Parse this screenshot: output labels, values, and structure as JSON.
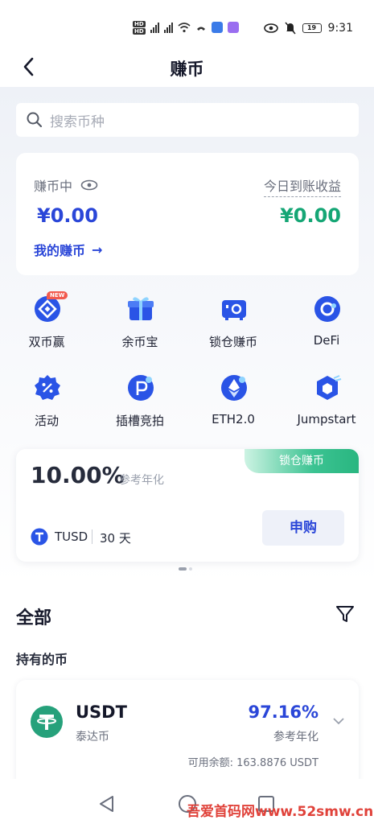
{
  "status_bar": {
    "time": "9:31",
    "battery": "19"
  },
  "header": {
    "title": "赚币"
  },
  "search": {
    "placeholder": "搜索币种"
  },
  "earnings": {
    "label": "赚币中",
    "amount": "¥0.00",
    "today_label": "今日到账收益",
    "today_amount": "¥0.00",
    "my_link": "我的赚币",
    "link_arrow": "→"
  },
  "grid": {
    "items": [
      {
        "label": "双币赢",
        "icon": "dual-coin-icon",
        "badge": "NEW"
      },
      {
        "label": "余币宝",
        "icon": "gift-box-icon"
      },
      {
        "label": "锁仓赚币",
        "icon": "safe-lock-icon"
      },
      {
        "label": "DeFi",
        "icon": "defi-icon"
      },
      {
        "label": "活动",
        "icon": "activity-percent-icon"
      },
      {
        "label": "插槽竞拍",
        "icon": "slot-auction-icon"
      },
      {
        "label": "ETH2.0",
        "icon": "ethereum-icon"
      },
      {
        "label": "Jumpstart",
        "icon": "jumpstart-icon"
      }
    ]
  },
  "promo": {
    "tag": "锁仓赚币",
    "rate": "10.00%",
    "rate_label": "参考年化",
    "coin": "TUSD",
    "days": "30 天",
    "button": "申购"
  },
  "all_section": {
    "title": "全部",
    "held_title": "持有的币"
  },
  "holding": {
    "coin": "USDT",
    "coin_cn": "泰达币",
    "rate": "97.16%",
    "rate_label": "参考年化",
    "balance": "可用余额: 163.8876 USDT"
  },
  "watermark": "吾爱首码网www.52smw.cn",
  "colors": {
    "accent_blue": "#2a46d8",
    "accent_green": "#15a675",
    "tether_green": "#26a17b"
  }
}
